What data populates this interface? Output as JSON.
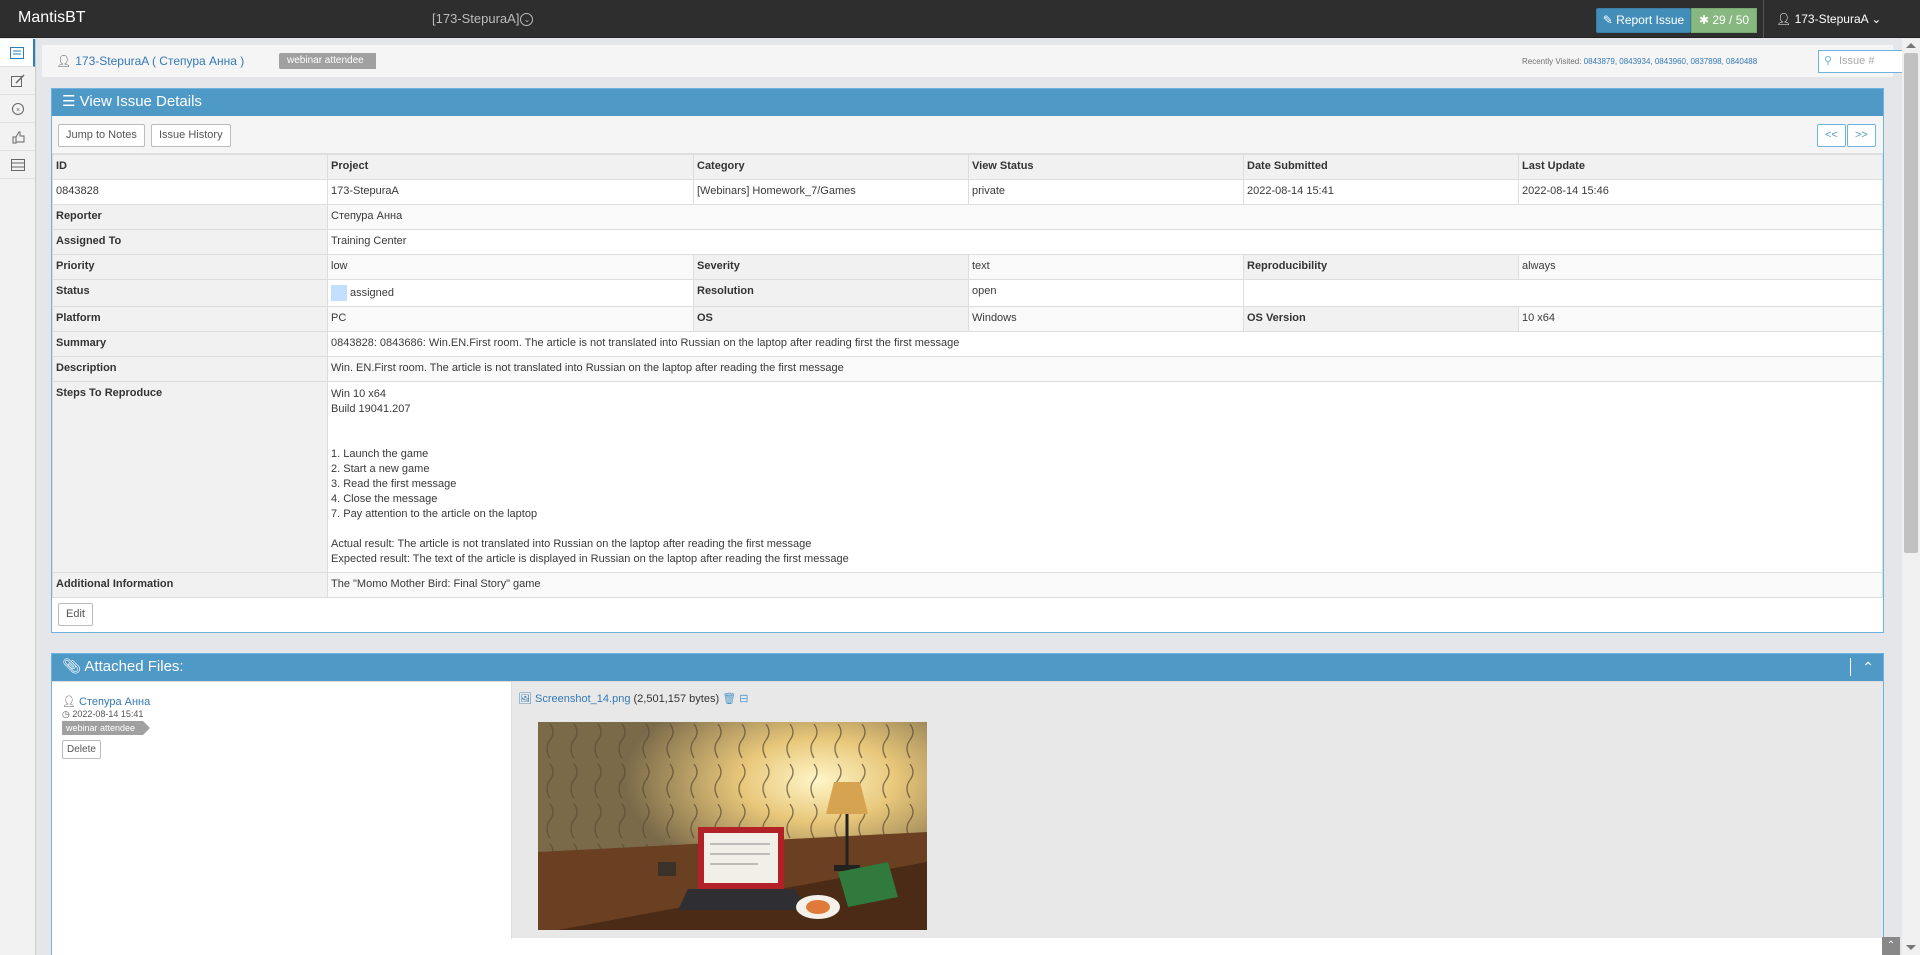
{
  "app": {
    "brand": "MantisBT",
    "project": "[173-StepuraA]"
  },
  "topnav": {
    "report_label": "Report Issue",
    "issue_count": "29 / 50",
    "user": "173-StepuraA"
  },
  "breadcrumb": {
    "user_link": "173-StepuraA ( Степура Анна )",
    "badge": "webinar attendee",
    "recent_label": "Recently Visited:",
    "recent_ids": "0843879, 0843934, 0843960, 0837898, 0840488",
    "search_placeholder": "Issue #"
  },
  "details": {
    "title": "View Issue Details",
    "jump_notes": "Jump to Notes",
    "history": "Issue History",
    "prev": "<<",
    "next": ">>",
    "headers": [
      "ID",
      "Project",
      "Category",
      "View Status",
      "Date Submitted",
      "Last Update"
    ],
    "values": [
      "0843828",
      "173-StepuraA",
      "[Webinars] Homework_7/Games",
      "private",
      "2022-08-14 15:41",
      "2022-08-14 15:46"
    ],
    "reporter_label": "Reporter",
    "reporter": "Степура Анна",
    "assigned_label": "Assigned To",
    "assigned": "Training Center",
    "priority_label": "Priority",
    "priority": "low",
    "severity_label": "Severity",
    "severity": "text",
    "repro_label": "Reproducibility",
    "repro": "always",
    "status_label": "Status",
    "status": "assigned",
    "resolution_label": "Resolution",
    "resolution": "open",
    "platform_label": "Platform",
    "platform": "PC",
    "os_label": "OS",
    "os": "Windows",
    "osver_label": "OS Version",
    "osver": "10 x64",
    "summary_label": "Summary",
    "summary": "0843828: 0843686: Win.EN.First room. The article is not translated into Russian on the laptop after reading first the first message",
    "description_label": "Description",
    "description": "Win. EN.First room. The article is not translated into Russian on the laptop after reading the first message",
    "steps_label": "Steps To Reproduce",
    "steps": {
      "env1": "Win 10 x64",
      "env2": "Build 19041.207",
      "s1": "1. Launch the game",
      "s2": "2. Start a new game",
      "s3": "3. Read the first message",
      "s4": "4. Close the message",
      "s5": "7. Pay attention to the article on the laptop",
      "actual": "Actual result: The article is not translated into Russian on the laptop after reading the first message",
      "expected": "Expected result: The text of the article is displayed in Russian on the laptop after reading the first message"
    },
    "additional_label": "Additional Information",
    "additional": "The \"Momo Mother Bird: Final Story\" game",
    "edit": "Edit"
  },
  "attachments": {
    "title": "Attached Files:",
    "user": "Степура Анна",
    "date": "2022-08-14 15:41",
    "badge": "webinar attendee",
    "delete": "Delete",
    "filename": "Screenshot_14.png",
    "size": "(2,501,157 bytes)"
  },
  "colors": {
    "header_blue": "#4f99c6",
    "navbar": "#2e2e2e",
    "report_btn": "#438eb9",
    "count_btn": "#87b87f"
  }
}
